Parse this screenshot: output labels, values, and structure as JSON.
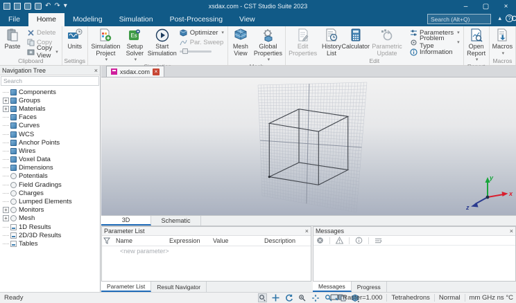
{
  "titlebar": {
    "title": "xsdax.com - CST Studio Suite 2023"
  },
  "menubar": {
    "tabs": [
      "File",
      "Home",
      "Modeling",
      "Simulation",
      "Post-Processing",
      "View"
    ],
    "search_placeholder": "Search (Alt+Q)"
  },
  "ribbon": {
    "clipboard": {
      "paste": "Paste",
      "delete": "Delete",
      "copy": "Copy",
      "copy_view": "Copy View",
      "label": "Clipboard"
    },
    "settings": {
      "units": "Units",
      "label": "Settings"
    },
    "simulation": {
      "project": "Simulation Project",
      "setup_solver": "Setup Solver",
      "start": "Start Simulation",
      "optimizer": "Optimizer",
      "par_sweep": "Par. Sweep",
      "label": "Simulation"
    },
    "mesh": {
      "mesh_view": "Mesh View",
      "global_properties": "Global Properties",
      "label": "Mesh"
    },
    "edit": {
      "edit_properties": "Edit Properties",
      "history_list": "History List",
      "calculator": "Calculator",
      "parametric_update": "Parametric Update",
      "parameters": "Parameters",
      "problem_type": "Problem Type",
      "information": "Information",
      "label": "Edit"
    },
    "report": {
      "open_report": "Open Report",
      "label": "Report"
    },
    "macros": {
      "macros": "Macros",
      "label": "Macros"
    }
  },
  "doc_tab": {
    "title": "xsdax.com"
  },
  "nav": {
    "title": "Navigation Tree",
    "search_placeholder": "Search",
    "items": [
      "Components",
      "Groups",
      "Materials",
      "Faces",
      "Curves",
      "WCS",
      "Anchor Points",
      "Wires",
      "Voxel Data",
      "Dimensions",
      "Potentials",
      "Field Gradings",
      "Charges",
      "Lumped Elements",
      "Monitors",
      "Mesh",
      "1D Results",
      "2D/3D Results",
      "Tables"
    ]
  },
  "viewport": {
    "tabs": [
      "3D",
      "Schematic"
    ],
    "axis": {
      "x": "x",
      "y": "y",
      "z": "z"
    }
  },
  "parameters": {
    "title": "Parameter List",
    "columns": [
      "Name",
      "Expression",
      "Value",
      "Description"
    ],
    "new_row": "<new parameter>",
    "tabs": [
      "Parameter List",
      "Result Navigator"
    ]
  },
  "messages": {
    "title": "Messages",
    "tabs": [
      "Messages",
      "Progress"
    ]
  },
  "statusbar": {
    "ready": "Ready",
    "raster": "Raster=1.000",
    "mesh_type": "Tetrahedrons",
    "mode": "Normal",
    "units": "mm GHz ns °C"
  },
  "colors": {
    "titlebar_blue": "#115a87",
    "accent_blue": "#1e6bb8",
    "doc_icon_magenta": "#cf1f9c"
  }
}
